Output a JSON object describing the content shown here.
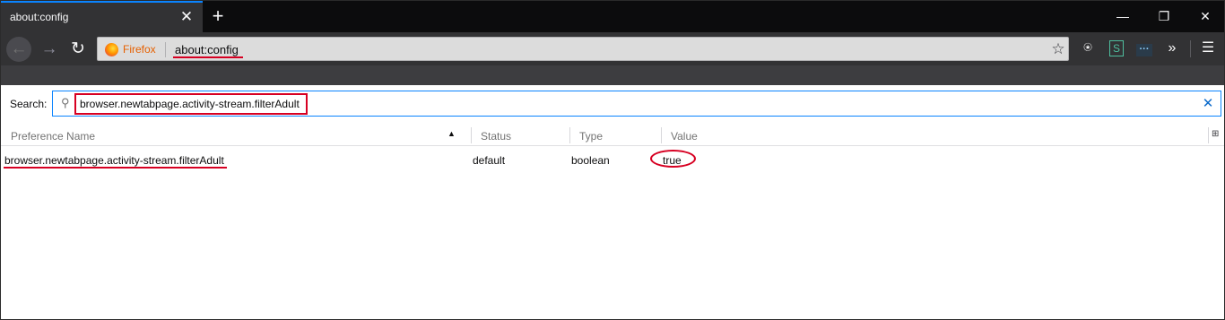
{
  "tab": {
    "title": "about:config"
  },
  "nav": {
    "identity_label": "Firefox",
    "url": "about:config"
  },
  "icons": {
    "close": "close-icon",
    "new_tab": "plus-icon",
    "back": "back-arrow-icon",
    "forward": "forward-arrow-icon",
    "reload": "reload-icon",
    "bookmark": "star-icon",
    "library": "library-icon",
    "overflow": "chevron-double-right-icon",
    "menu": "hamburger-menu-icon",
    "search": "magnifier-icon",
    "column_picker": "column-picker-icon"
  },
  "search": {
    "label": "Search:",
    "value": "browser.newtabpage.activity-stream.filterAdult"
  },
  "table": {
    "columns": [
      "Preference Name",
      "Status",
      "Type",
      "Value"
    ],
    "rows": [
      {
        "name": "browser.newtabpage.activity-stream.filterAdult",
        "status": "default",
        "type": "boolean",
        "value": "true"
      }
    ]
  },
  "colors": {
    "accent": "#0a84ff",
    "highlight": "#d70022",
    "firefox_label": "#e66000"
  }
}
